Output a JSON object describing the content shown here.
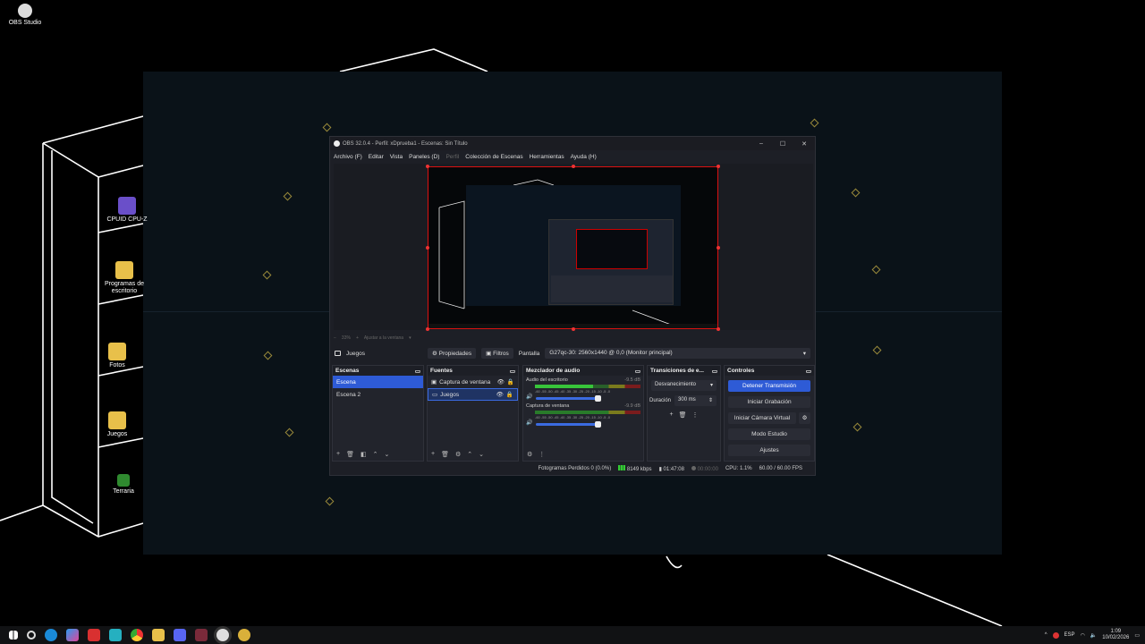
{
  "desktop": {
    "top_left_icon": "OBS Studio",
    "icons": [
      {
        "label": "CPUID CPU-Z",
        "icon": "cpu-z-icon"
      },
      {
        "label": "Programas de escritorio",
        "icon": "folder-icon"
      },
      {
        "label": "Fotos",
        "icon": "folder-icon"
      },
      {
        "label": "Juegos",
        "icon": "folder-icon"
      },
      {
        "label": "Terraria",
        "icon": "terraria-icon"
      }
    ]
  },
  "obs": {
    "title": "OBS 32.0.4 - Perfil: xDprueba1 - Escenas: Sin Título",
    "window_controls": {
      "minimize": "–",
      "maximize": "☐",
      "close": "✕"
    },
    "menu": [
      "Archivo (F)",
      "Editar",
      "Vista",
      "Paneles (D)",
      "Perfil",
      "Colección de Escenas",
      "Herramientas",
      "Ayuda (H)"
    ],
    "zoom": {
      "minus": "−",
      "value": "33%",
      "plus": "+",
      "fit": "Ajustar a la ventana",
      "dropdown": "▾"
    },
    "source_toolbar": {
      "current_source": "Juegos",
      "properties": "Propiedades",
      "filters": "Filtros",
      "display_label": "Pantalla",
      "display_value": "G27qc-30: 2560x1440 @ 0,0 (Monitor principal)"
    },
    "scenes": {
      "title": "Escenas",
      "items": [
        "Escena",
        "Escena 2"
      ]
    },
    "sources": {
      "title": "Fuentes",
      "items": [
        "Captura de ventana",
        "Juegos"
      ]
    },
    "mixer": {
      "title": "Mezclador de audio",
      "tracks": [
        {
          "name": "Audio del escritorio",
          "db": "-9.5 dB"
        },
        {
          "name": "Captura de ventana",
          "db": "-9.9 dB"
        }
      ],
      "scale": "-60 -55 -50 -45 -40 -35 -30 -25 -20 -15 -10 -5 -0"
    },
    "transitions": {
      "title": "Transiciones de e...",
      "type": "Desvanecimiento",
      "duration_label": "Duración",
      "duration_value": "300 ms"
    },
    "controls": {
      "title": "Controles",
      "buttons": [
        "Detener Transmisión",
        "Iniciar Grabación",
        "Iniciar Cámara Virtual",
        "Modo Estudio",
        "Ajustes"
      ]
    },
    "status": {
      "dropped": "Fotogramas Perdidos 0 (0.0%)",
      "bitrate": "8149 kbps",
      "stream_time": "01:47:08",
      "rec_time": "00:00:00",
      "cpu": "CPU: 1.1%",
      "fps": "60.00 / 60.00 FPS"
    }
  },
  "taskbar": {
    "language": "ESP",
    "time": "1:09",
    "date": "10/02/2026",
    "tray_chevron": "^"
  },
  "colors": {
    "accent": "#2e5bd6",
    "preview_border": "#dd1111"
  }
}
